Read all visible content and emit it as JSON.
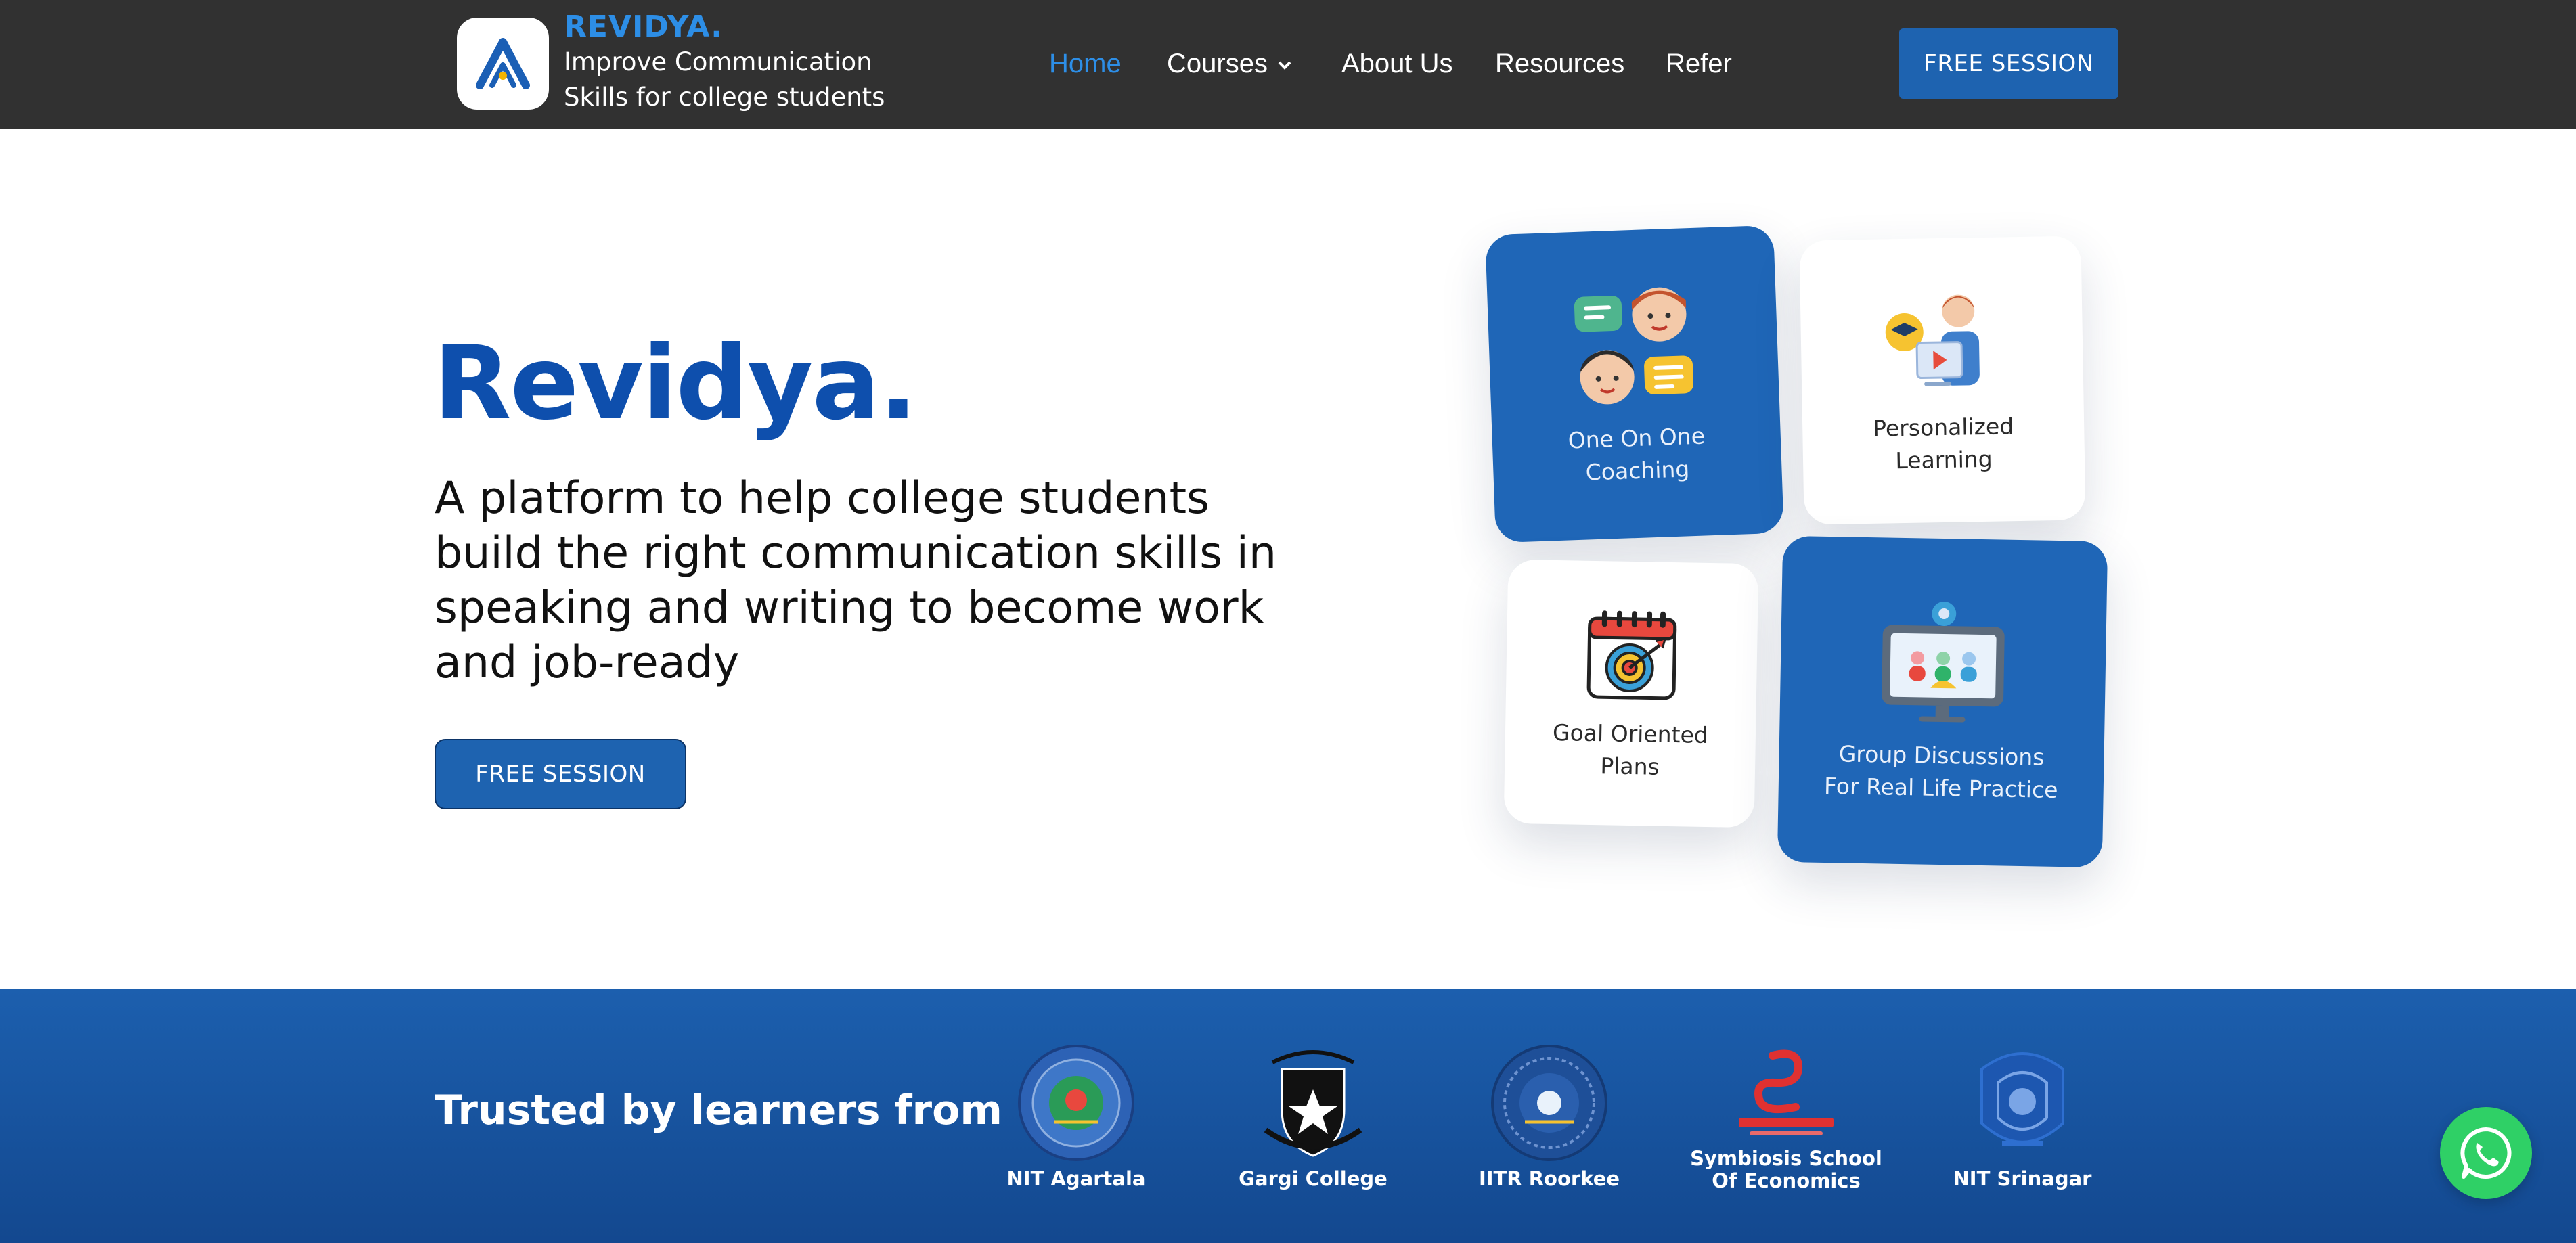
{
  "header": {
    "brand_name": "REVIDYA.",
    "brand_tagline": "Improve Communication Skills for college students",
    "logo_icon": "revidya-logo-icon",
    "nav": [
      {
        "label": "Home",
        "active": true
      },
      {
        "label": "Courses",
        "has_dropdown": true
      },
      {
        "label": "About Us"
      },
      {
        "label": "Resources"
      },
      {
        "label": "Refer"
      }
    ],
    "cta_label": "FREE SESSION"
  },
  "hero": {
    "title": "Revidya.",
    "description": "A platform to help college students build the right communication skills in speaking and writing to become work and job-ready",
    "cta_label": "FREE SESSION"
  },
  "features": [
    {
      "label": "One On One Coaching",
      "style": "blue",
      "icon": "coaching-chat-icon"
    },
    {
      "label": "Personalized Learning",
      "style": "white",
      "icon": "teacher-icon"
    },
    {
      "label": "Goal Oriented Plans",
      "style": "white",
      "icon": "target-calendar-icon"
    },
    {
      "label": "Group Discussions For Real Life Practice",
      "style": "blue",
      "icon": "group-monitor-icon"
    }
  ],
  "trusted": {
    "heading": "Trusted by learners from",
    "institutions": [
      {
        "name": "NIT Agartala",
        "icon": "nit-agartala-seal"
      },
      {
        "name": "Gargi College",
        "icon": "gargi-college-crest"
      },
      {
        "name": "IITR Roorkee",
        "icon": "iitr-roorkee-seal"
      },
      {
        "name": "Symbiosis School Of Economics",
        "icon": "symbiosis-logo"
      },
      {
        "name": "NIT Srinagar",
        "icon": "nit-srinagar-emblem"
      }
    ]
  },
  "whatsapp": {
    "icon": "whatsapp-icon"
  },
  "colors": {
    "header_bg": "#313131",
    "accent": "#2d8ee6",
    "primary_blue": "#1f66b7",
    "title_blue": "#0e4fad",
    "whatsapp_green": "#2fd066"
  }
}
